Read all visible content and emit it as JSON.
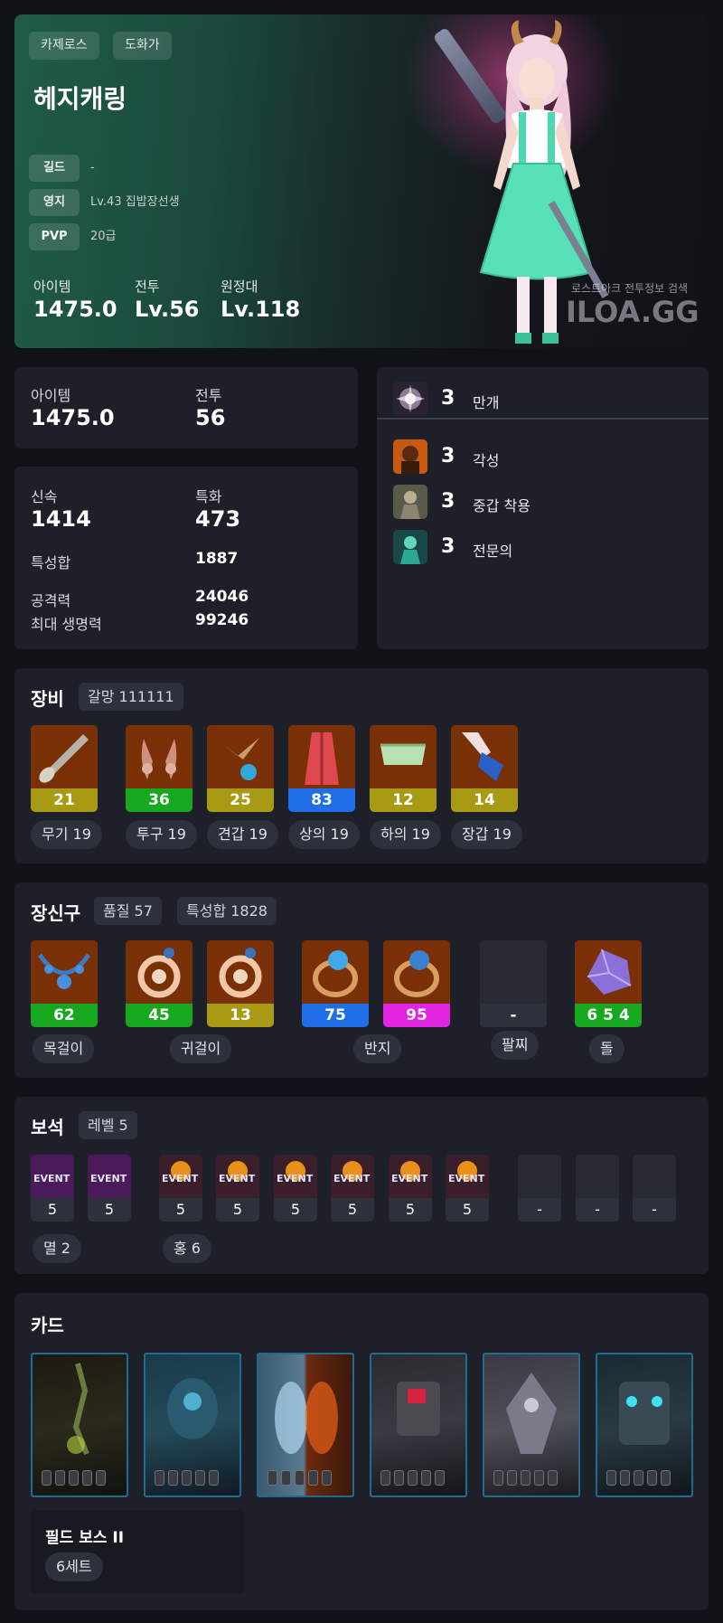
{
  "profile": {
    "server": "카제로스",
    "class": "도화가",
    "name": "헤지캐링",
    "guild_label": "길드",
    "guild_value": "-",
    "estate_label": "영지",
    "estate_value": "Lv.43 집밥장선생",
    "pvp_label": "PVP",
    "pvp_value": "20급",
    "item_label": "아이템",
    "item_value": "1475.0",
    "combat_label": "전투",
    "combat_value": "Lv.56",
    "expedition_label": "원정대",
    "expedition_value": "Lv.118",
    "watermark_small": "로스트아크 전투정보 검색",
    "watermark_big": "ILOA.GG"
  },
  "summary": {
    "item_label": "아이템",
    "item_value": "1475.0",
    "combat_label": "전투",
    "combat_value": "56"
  },
  "stats": {
    "swiftness_label": "신속",
    "swiftness_value": "1414",
    "specialization_label": "특화",
    "specialization_value": "473",
    "total_label": "특성합",
    "total_value": "1887",
    "attack_label": "공격력",
    "attack_value": "24046",
    "hp_label": "최대 생명력",
    "hp_value": "99246"
  },
  "engravings": {
    "ark": {
      "level": "3",
      "name": "만개"
    },
    "list": [
      {
        "level": "3",
        "name": "각성"
      },
      {
        "level": "3",
        "name": "중갑 착용"
      },
      {
        "level": "3",
        "name": "전문의"
      }
    ]
  },
  "equipment": {
    "title": "장비",
    "tempering": "갈망 111111",
    "items": [
      {
        "quality": "21",
        "label": "무기 19",
        "color": "#a89a12"
      },
      {
        "quality": "36",
        "label": "투구 19",
        "color": "#16a81e"
      },
      {
        "quality": "25",
        "label": "견갑 19",
        "color": "#a89a12"
      },
      {
        "quality": "83",
        "label": "상의 19",
        "color": "#1f6ee8"
      },
      {
        "quality": "12",
        "label": "하의 19",
        "color": "#a89a12"
      },
      {
        "quality": "14",
        "label": "장갑 19",
        "color": "#a89a12"
      }
    ]
  },
  "accessories": {
    "title": "장신구",
    "quality_badge": "품질 57",
    "stat_badge": "특성합 1828",
    "items": [
      {
        "quality": "62",
        "color": "#16a81e"
      },
      {
        "quality": "45",
        "color": "#16a81e"
      },
      {
        "quality": "13",
        "color": "#a89a12"
      },
      {
        "quality": "75",
        "color": "#1f6ee8"
      },
      {
        "quality": "95",
        "color": "#e024e0"
      },
      {
        "quality": "-",
        "color": "#2d313c"
      },
      {
        "quality": "6 5 4",
        "color": "#16a81e"
      }
    ],
    "labels": {
      "necklace": "목걸이",
      "earring": "귀걸이",
      "ring": "반지",
      "bracelet": "팔찌",
      "stone": "돌"
    }
  },
  "gems": {
    "title": "보석",
    "level_badge": "레벨 5",
    "event_text": "EVENT",
    "levels": [
      "5",
      "5",
      "5",
      "5",
      "5",
      "5",
      "5",
      "5",
      "-",
      "-",
      "-"
    ],
    "annihilation_label": "멸 2",
    "crimson_label": "홍 6"
  },
  "cards": {
    "title": "카드",
    "set_name": "필드 보스 II",
    "set_count": "6세트"
  }
}
